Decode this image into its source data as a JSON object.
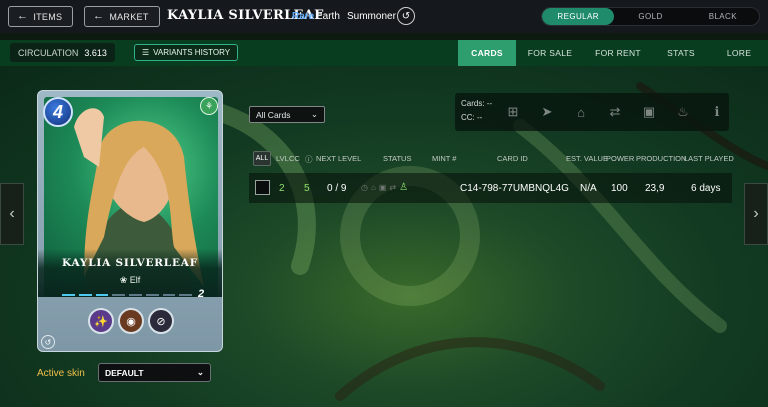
{
  "header": {
    "items_button": "ITEMS",
    "market_button": "MARKET",
    "card_title": "KAYLIA SILVERLEAF",
    "rarity": "Rare",
    "element": "Earth",
    "card_type": "Summoner",
    "editions": [
      "REGULAR",
      "GOLD",
      "BLACK"
    ],
    "active_edition": "REGULAR"
  },
  "subbar": {
    "circulation_label": "CIRCULATION",
    "circulation_value": "3.613",
    "variants_history": "VARIANTS HISTORY",
    "tabs": [
      "CARDS",
      "FOR SALE",
      "FOR RENT",
      "STATS",
      "LORE"
    ],
    "active_tab": "CARDS"
  },
  "card": {
    "mana": "4",
    "name": "KAYLIA SILVERLEAF",
    "race": "Elf",
    "level": "2",
    "level_pips_total": 8,
    "level_pips_filled": 3
  },
  "skin": {
    "label": "Active skin",
    "value": "DEFAULT"
  },
  "filters": {
    "cards_select": "All Cards"
  },
  "toolbar": {
    "cards_label": "Cards: --",
    "cc_label": "CC: --",
    "icons": [
      "add-icon",
      "send-icon",
      "market-icon",
      "transfer-icon",
      "lock-icon",
      "burn-icon",
      "info-icon"
    ]
  },
  "table": {
    "all_label": "ALL",
    "headers": [
      "LVL",
      "CC",
      "NEXT LEVEL",
      "STATUS",
      "MINT #",
      "CARD ID",
      "EST. VALUE",
      "POWER",
      "PRODUCTION",
      "LAST PLAYED"
    ],
    "rows": [
      {
        "lvl": "2",
        "cc": "5",
        "next_level": "0 / 9",
        "card_id": "C14-798-77UMBNQL4G",
        "est_value": "N/A",
        "power": "100",
        "production": "23,9",
        "last_played": "6 days"
      }
    ]
  },
  "colors": {
    "accent_green": "#2f9e6e",
    "rarity_blue": "#5ea9ff",
    "skin_label_gold": "#f0c04a"
  }
}
